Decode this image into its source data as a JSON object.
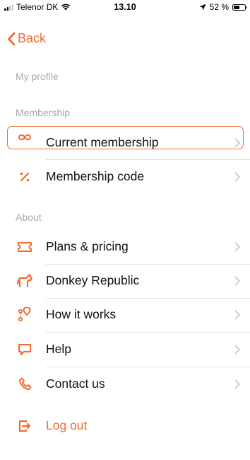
{
  "status_bar": {
    "carrier": "Telenor DK",
    "time": "13.10",
    "battery_percent": "52 %",
    "battery_level": 0.52,
    "signal_bars": 2
  },
  "nav": {
    "back_label": "Back"
  },
  "sections": {
    "profile": "My profile",
    "membership": "Membership",
    "about": "About"
  },
  "membership_items": [
    {
      "label": "Current membership",
      "icon": "infinity-icon",
      "selected": true
    },
    {
      "label": "Membership code",
      "icon": "percent-icon",
      "selected": false
    }
  ],
  "about_items": [
    {
      "label": "Plans & pricing",
      "icon": "ticket-icon"
    },
    {
      "label": "Donkey Republic",
      "icon": "donkey-icon"
    },
    {
      "label": "How it works",
      "icon": "location-pins-icon"
    },
    {
      "label": "Help",
      "icon": "chat-bubble-icon"
    },
    {
      "label": "Contact us",
      "icon": "phone-icon"
    }
  ],
  "logout": {
    "label": "Log out",
    "icon": "logout-icon"
  },
  "colors": {
    "accent": "#f26b2e",
    "section_header": "#a9a9a9",
    "divider": "#e3e3e3",
    "chevron": "#c7c7cc"
  }
}
